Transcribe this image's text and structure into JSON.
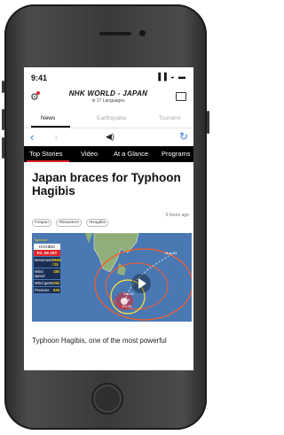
{
  "status": {
    "time": "9:41",
    "icons": "▐▐ ◒ ▬"
  },
  "app": {
    "brand_title": "NHK WORLD - JAPAN",
    "brand_subtitle": "in 17 Languages",
    "gear_icon": "⚙",
    "tabs": [
      {
        "label": "News",
        "active": true
      },
      {
        "label": "Earthquake",
        "active": false
      },
      {
        "label": "Tsunami",
        "active": false
      }
    ]
  },
  "nav": {
    "back": "‹",
    "forward": "›",
    "sound": "◀)",
    "reload": "↻"
  },
  "categories": [
    "Top Stories",
    "Video",
    "At a Glance",
    "Programs"
  ],
  "article": {
    "headline": "Japan braces for Typhoon Hagibis",
    "hashtags": [
      "#Japan",
      "#Disasters",
      "#Hagibis"
    ],
    "time_ago": "5 hours ago",
    "body_start": "Typhoon Hagibis, one of the most powerful"
  },
  "video": {
    "header": "Typhoon",
    "name": "HAGIBIS",
    "date": "Fri. 09 JST",
    "rows": [
      {
        "label": "Movement",
        "value": "NNW / 25"
      },
      {
        "label": "Wind speed",
        "value": "180"
      },
      {
        "label": "Wind gusts",
        "value": "252"
      },
      {
        "label": "Pressure",
        "value": "925"
      }
    ],
    "map_labels": [
      "Mon.03",
      "Sat.09",
      "Fri.18",
      "Fri.09"
    ]
  },
  "colors": {
    "accent": "#2f7cd6",
    "brand_red": "#e0242a",
    "category_bar": "#000000"
  }
}
